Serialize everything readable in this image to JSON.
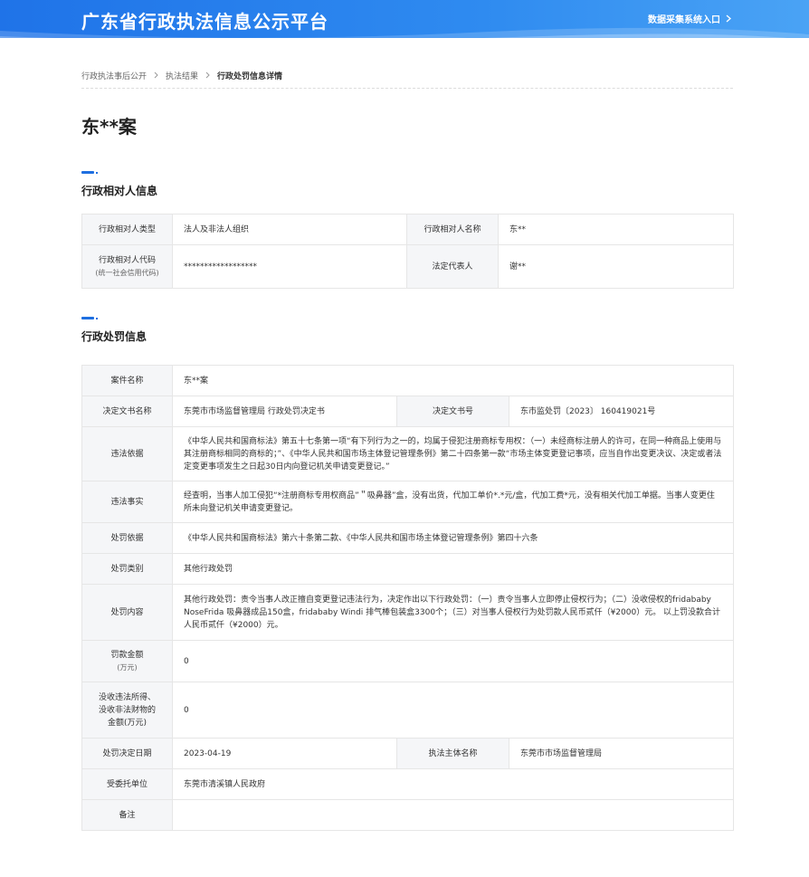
{
  "header": {
    "site_title": "广东省行政执法信息公示平台",
    "entry_link": "数据采集系统入口",
    "entry_icon": "chevron-right-icon",
    "brand_color": "#1f73e8"
  },
  "breadcrumb": {
    "items": [
      "行政执法事后公开",
      "执法结果",
      "行政处罚信息详情"
    ],
    "separator_icon": "chevron-right-icon"
  },
  "case_title": "东**案",
  "party_section": {
    "title": "行政相对人信息",
    "rows": [
      {
        "label1": "行政相对人类型",
        "value1": "法人及非法人组织",
        "label2": "行政相对人名称",
        "value2": "东**"
      },
      {
        "label1": "行政相对人代码",
        "label1_note": "(统一社会信用代码)",
        "value1": "******************",
        "label2": "法定代表人",
        "value2": "谢**"
      }
    ]
  },
  "penalty_section": {
    "title": "行政处罚信息",
    "case_name_label": "案件名称",
    "case_name": "东**案",
    "doc_name_label": "决定文书名称",
    "doc_name": "东莞市市场监督管理局 行政处罚决定书",
    "doc_no_label": "决定文书号",
    "doc_no": "东市监处罚〔2023〕 160419021号",
    "violation_basis_label": "违法依据",
    "violation_basis": "《中华人民共和国商标法》第五十七条第一项“有下列行为之一的，均属于侵犯注册商标专用权：（一）未经商标注册人的许可，在同一种商品上使用与其注册商标相同的商标的；”、《中华人民共和国市场主体登记管理条例》第二十四条第一款“市场主体变更登记事项，应当自作出变更决议、决定或者法定变更事项发生之日起30日内向登记机关申请变更登记。”",
    "violation_facts_label": "违法事实",
    "violation_facts": "经查明，当事人加工侵犯“*注册商标专用权商品”＂吸鼻器”盒，没有出货，代加工单价*.*元/盒，代加工费*元，没有相关代加工单据。当事人变更住所未向登记机关申请变更登记。",
    "penalty_basis_label": "处罚依据",
    "penalty_basis": "《中华人民共和国商标法》第六十条第二款、《中华人民共和国市场主体登记管理条例》第四十六条",
    "penalty_type_label": "处罚类别",
    "penalty_type": "其他行政处罚",
    "penalty_content_label": "处罚内容",
    "penalty_content": "其他行政处罚：责令当事人改正擅自变更登记违法行为，决定作出以下行政处罚：（一）责令当事人立即停止侵权行为；（二）没收侵权的fridababy NoseFrida 吸鼻器成品150盒，fridababy Windi 排气棒包装盒3300个；（三）对当事人侵权行为处罚款人民币贰仟（¥2000）元。 以上罚没款合计人民币贰仟（¥2000）元。",
    "fine_label": "罚款金额",
    "fine_unit": "(万元)",
    "fine_amount": "0",
    "confiscation_label_1": "没收违法所得、",
    "confiscation_label_2": "没收非法财物的",
    "confiscation_label_3": "金额(万元)",
    "confiscation_amount": "0",
    "decision_date_label": "处罚决定日期",
    "decision_date": "2023-04-19",
    "authority_label": "执法主体名称",
    "authority": "东莞市市场监督管理局",
    "entrusted_label": "受委托单位",
    "entrusted": "东莞市清溪镇人民政府",
    "remark_label": "备注",
    "remark": ""
  }
}
